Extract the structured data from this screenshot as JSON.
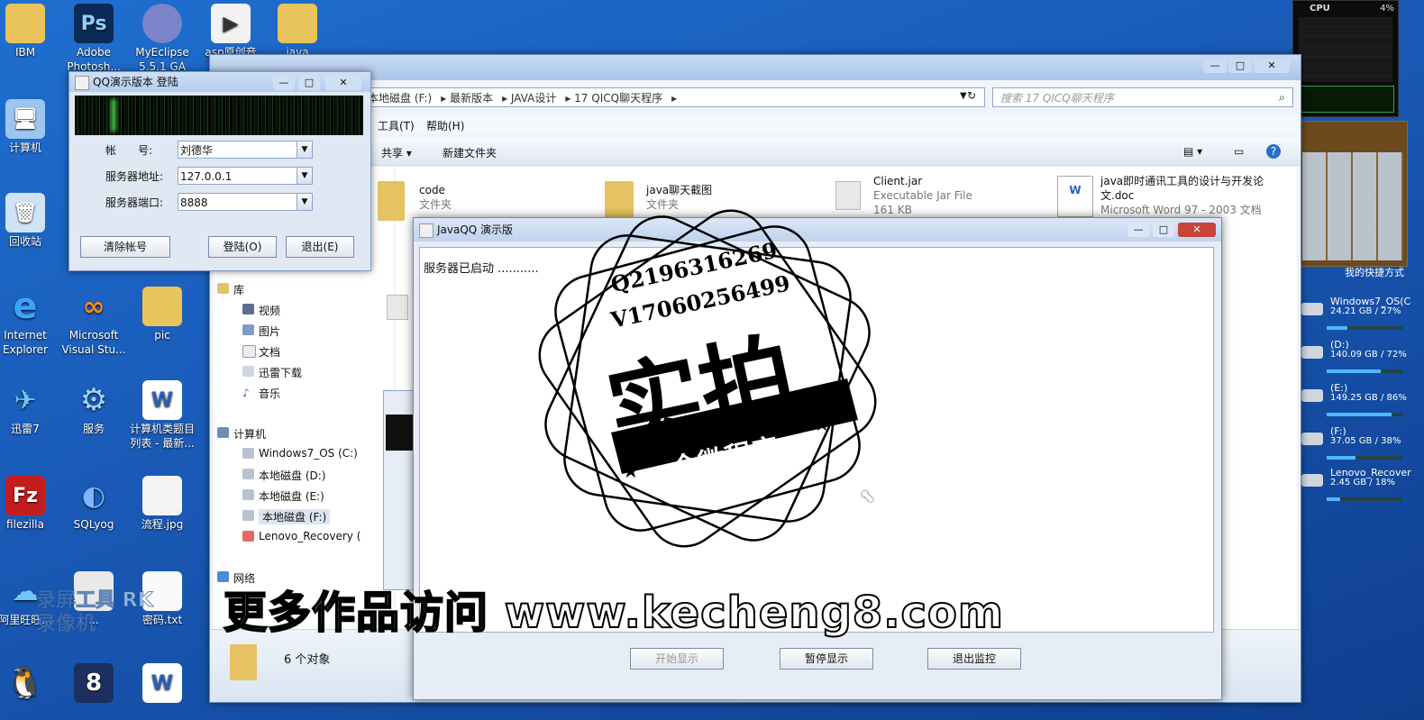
{
  "desktop": {
    "icons": [
      {
        "label": "IBM"
      },
      {
        "label": "Adobe Photosh..."
      },
      {
        "label": "MyEclipse 5.5.1 GA"
      },
      {
        "label": "asp原创音乐..."
      },
      {
        "label": "java"
      },
      {
        "label": "计算机"
      },
      {
        "label": "回收站"
      },
      {
        "label": "Internet Explorer"
      },
      {
        "label": "Microsoft Visual Stu..."
      },
      {
        "label": "pic"
      },
      {
        "label": "迅雷7"
      },
      {
        "label": "服务"
      },
      {
        "label": "计算机类题目列表 - 最新..."
      },
      {
        "label": "filezilla"
      },
      {
        "label": "SQLyog"
      },
      {
        "label": "流程.jpg"
      },
      {
        "label": "阿里旺旺..."
      },
      {
        "label": "..."
      },
      {
        "label": "密码.txt"
      }
    ]
  },
  "explorer": {
    "address": [
      "本地磁盘 (F:)",
      "最新版本",
      "JAVA设计",
      "17 QICQ聊天程序"
    ],
    "search_placeholder": "搜索 17 QICQ聊天程序",
    "menu": [
      "工具(T)",
      "帮助(H)"
    ],
    "toolbar": {
      "share": "共享 ▾",
      "new_folder": "新建文件夹"
    },
    "nav": {
      "library": "库",
      "video": "视频",
      "pictures": "图片",
      "documents": "文档",
      "xunlei": "迅雷下载",
      "music": "音乐",
      "computer": "计算机",
      "drive_c": "Windows7_OS (C:)",
      "drive_d": "本地磁盘 (D:)",
      "drive_e": "本地磁盘 (E:)",
      "drive_f": "本地磁盘 (F:)",
      "lenovo": "Lenovo_Recovery (",
      "network": "网络"
    },
    "files": [
      {
        "name": "code",
        "type": "文件夹"
      },
      {
        "name": "java聊天截图",
        "type": "文件夹"
      },
      {
        "name": "Client.jar",
        "type": "Executable Jar File",
        "size": "161 KB"
      },
      {
        "name": "java即时通讯工具的设计与开发论文.doc",
        "type": "Microsoft Word 97 - 2003 文档"
      }
    ],
    "status": "6 个对象"
  },
  "qq_login": {
    "title": "QQ演示版本 登陆",
    "account_label": "帐　　号:",
    "account_value": "刘德华",
    "server_label": "服务器地址:",
    "server_value": "127.0.0.1",
    "port_label": "服务器端口:",
    "port_value": "8888",
    "clear_btn": "清除帐号",
    "login_btn": "登陆(O)",
    "exit_btn": "退出(E)"
  },
  "javaqq": {
    "title": "JavaQQ 演示版",
    "log": "服务器已启动 ...........",
    "start_btn": "开始显示",
    "pause_btn": "暂停显示",
    "exit_btn": "退出监控"
  },
  "gadgets": {
    "cpu_label": "CPU",
    "cpu_value": "4%",
    "drives": [
      {
        "name": "Windows7_OS(C",
        "info": "24.21 GB / 27%",
        "used": 0.27
      },
      {
        "name": "(D:)",
        "info": "140.09 GB / 72%",
        "used": 0.72
      },
      {
        "name": "(E:)",
        "info": "149.25 GB / 86%",
        "used": 0.86
      },
      {
        "name": "(F:)",
        "info": "37.05 GB / 38%",
        "used": 0.38
      },
      {
        "name": "Lenovo_Recover",
        "info": "2.45 GB / 18%",
        "used": 0.18
      }
    ],
    "shortcut": "我的快捷方式"
  },
  "overlay": {
    "stamp_line1": "Q2196316269",
    "stamp_line2": "V17060256499",
    "stamp_big": "实拍",
    "stamp_ribbon": "全微程序",
    "watermark": "更多作品访问 www.kecheng8.com",
    "recorder": "录屏工具 RK录像机"
  }
}
